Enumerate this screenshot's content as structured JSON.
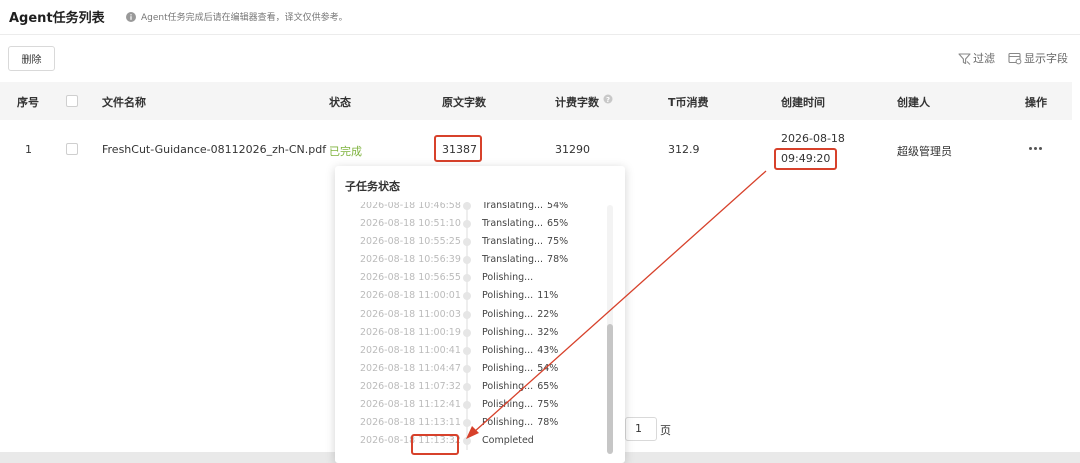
{
  "header": {
    "title": "Agent任务列表",
    "note": "Agent任务完成后请在编辑器查看，译文仅供参考。",
    "info_icon": "info-icon"
  },
  "toolbar": {
    "delete_label": "删除",
    "filter_label": "过滤",
    "fields_label": "显示字段",
    "filter_icon": "filter-icon",
    "fields_icon": "columns-icon"
  },
  "table": {
    "columns": {
      "index": "序号",
      "file_name": "文件名称",
      "status": "状态",
      "source_chars": "原文字数",
      "billed_chars": "计费字数",
      "t_coin": "T币消费",
      "created_time": "创建时间",
      "creator": "创建人",
      "actions": "操作"
    },
    "rows": [
      {
        "index": "1",
        "file_name": "FreshCut-Guidance-08112026_zh-CN.pdf",
        "status": "已完成",
        "source_chars": "31387",
        "billed_chars": "31290",
        "t_coin": "312.9",
        "created_date": "2026-08-18",
        "created_time": "09:49:20",
        "creator": "超级管理员"
      }
    ]
  },
  "subtask_popover": {
    "title": "子任务状态",
    "logs": [
      {
        "time": "2026-08-18 10:46:58",
        "status": "Translating...",
        "percent": "54%"
      },
      {
        "time": "2026-08-18 10:51:10",
        "status": "Translating...",
        "percent": "65%"
      },
      {
        "time": "2026-08-18 10:55:25",
        "status": "Translating...",
        "percent": "75%"
      },
      {
        "time": "2026-08-18 10:56:39",
        "status": "Translating...",
        "percent": "78%"
      },
      {
        "time": "2026-08-18 10:56:55",
        "status": "Polishing...",
        "percent": ""
      },
      {
        "time": "2026-08-18 11:00:01",
        "status": "Polishing...",
        "percent": "11%"
      },
      {
        "time": "2026-08-18 11:00:03",
        "status": "Polishing...",
        "percent": "22%"
      },
      {
        "time": "2026-08-18 11:00:19",
        "status": "Polishing...",
        "percent": "32%"
      },
      {
        "time": "2026-08-18 11:00:41",
        "status": "Polishing...",
        "percent": "43%"
      },
      {
        "time": "2026-08-18 11:04:47",
        "status": "Polishing...",
        "percent": "54%"
      },
      {
        "time": "2026-08-18 11:07:32",
        "status": "Polishing...",
        "percent": "65%"
      },
      {
        "time": "2026-08-18 11:12:41",
        "status": "Polishing...",
        "percent": "75%"
      },
      {
        "time": "2026-08-18 11:13:11",
        "status": "Polishing...",
        "percent": "78%"
      },
      {
        "time": "2026-08-18 11:13:32",
        "status": "Completed",
        "percent": ""
      }
    ]
  },
  "pagination": {
    "current_page": "1",
    "suffix": "页"
  },
  "colors": {
    "status_done": "#7fb33f",
    "highlight": "#d7412b"
  }
}
